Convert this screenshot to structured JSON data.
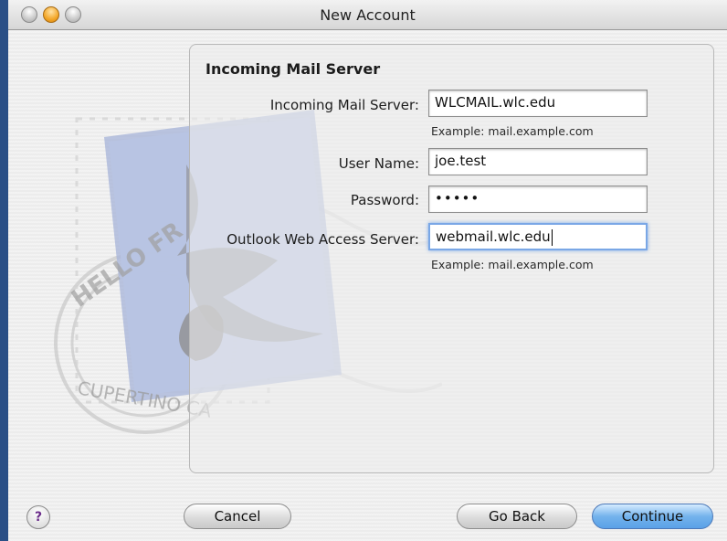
{
  "window": {
    "title": "New Account"
  },
  "section": {
    "title": "Incoming Mail Server"
  },
  "fields": {
    "incoming_server": {
      "label": "Incoming Mail Server:",
      "value": "WLCMAIL.wlc.edu",
      "hint": "Example: mail.example.com"
    },
    "user_name": {
      "label": "User Name:",
      "value": "joe.test"
    },
    "password": {
      "label": "Password:",
      "value": "•••••"
    },
    "owa_server": {
      "label": "Outlook Web Access Server:",
      "value": "webmail.wlc.edu",
      "hint": "Example: mail.example.com"
    }
  },
  "stamp": {
    "top_text": "HELLO FR",
    "bottom_text": "CUPERTINO CA"
  },
  "buttons": {
    "help": "?",
    "cancel": "Cancel",
    "go_back": "Go Back",
    "continue": "Continue"
  },
  "colors": {
    "accent": "#5aa1e7",
    "desktop": "#2a4f86"
  }
}
